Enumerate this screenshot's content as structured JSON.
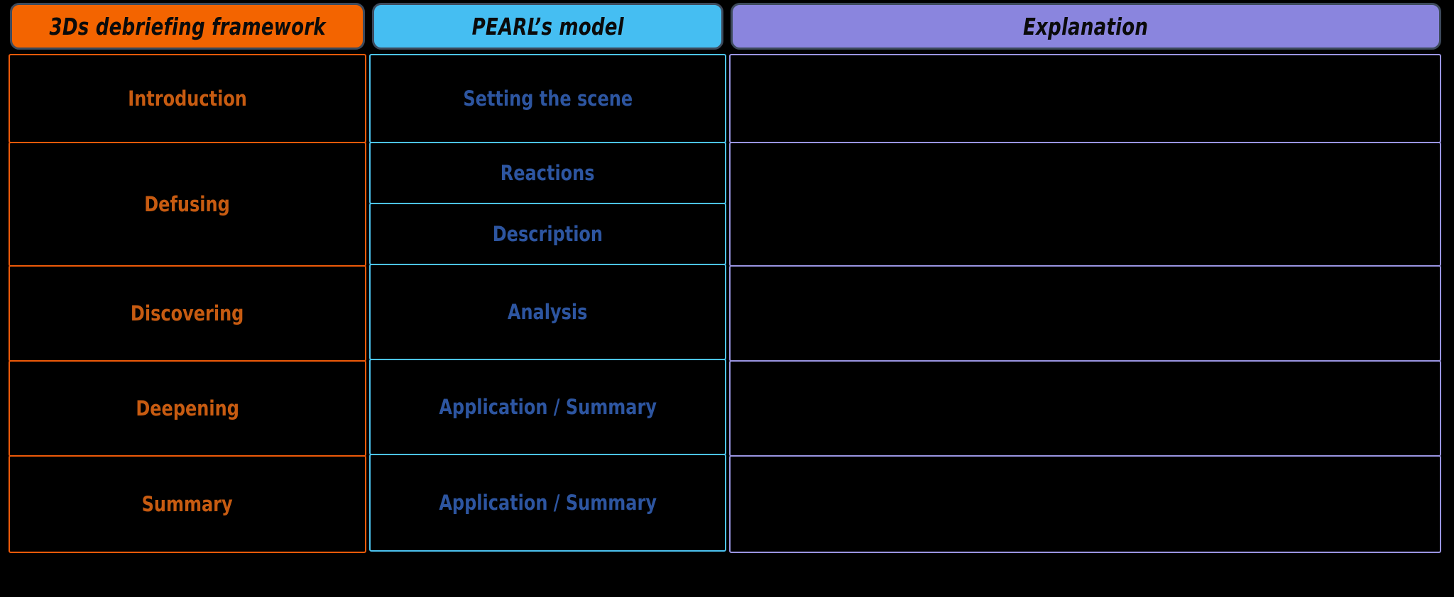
{
  "table": {
    "columns": [
      {
        "id": "col-3ds",
        "header": "3Ds debriefing framework",
        "header_bg": "#F36400",
        "text_color": "#C75B11",
        "border_color": "#EE5A09"
      },
      {
        "id": "col-pearl",
        "header": "PEARL’s model",
        "header_bg": "#45BEF2",
        "text_color": "#2D55A0",
        "border_color": "#4CC3F0"
      },
      {
        "id": "col-explain",
        "header": "Explanation",
        "header_bg": "#8A85DE",
        "text_color": "#9A95E2",
        "border_color": "#9A95E2"
      }
    ],
    "rows": [
      {
        "framework": "Introduction",
        "pearl": [
          "Setting the scene"
        ],
        "explanation": ""
      },
      {
        "framework": "Defusing",
        "pearl": [
          "Reactions",
          "Description"
        ],
        "explanation": ""
      },
      {
        "framework": "Discovering",
        "pearl": [
          "Analysis"
        ],
        "explanation": ""
      },
      {
        "framework": "Deepening",
        "pearl": [
          "Application / Summary"
        ],
        "explanation": ""
      },
      {
        "framework": "Summary",
        "pearl": [
          "Application / Summary"
        ],
        "explanation": ""
      }
    ]
  },
  "colors": {
    "background": "#000000",
    "header_outline": "#3d4a5c",
    "header_text": "#0b0b0b"
  }
}
